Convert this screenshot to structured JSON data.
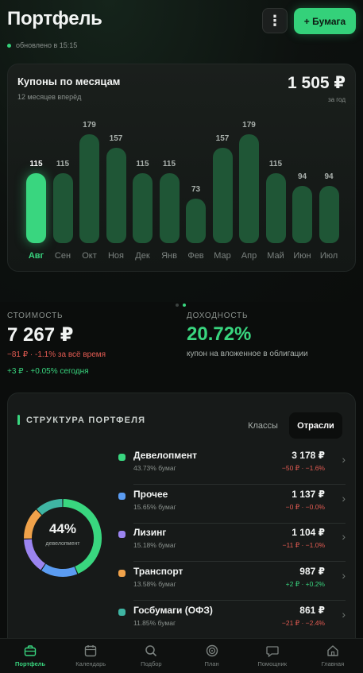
{
  "header": {
    "title": "Портфель",
    "menu_label": "⋮",
    "add_label": "+ Бумага",
    "updated": "обновлено в 15:15"
  },
  "coupons": {
    "title": "Купоны по месяцам",
    "subtitle": "12 месяцев вперёд",
    "total": "1 505 ₽",
    "total_label": "за год"
  },
  "chart_data": {
    "type": "bar",
    "title": "Купоны по месяцам",
    "categories": [
      "Авг",
      "Сен",
      "Окт",
      "Ноя",
      "Дек",
      "Янв",
      "Фев",
      "Мар",
      "Апр",
      "Май",
      "Июн",
      "Июл"
    ],
    "values": [
      115,
      115,
      179,
      157,
      115,
      115,
      73,
      157,
      179,
      115,
      94,
      94
    ],
    "active_index": 0,
    "ylim": [
      0,
      179
    ],
    "grid": false,
    "colors": {
      "bar": "#1f5636",
      "active": "#39d67f"
    }
  },
  "stats": {
    "value_label": "СТОИМОСТЬ",
    "value": "7 267 ₽",
    "change_total": "−81 ₽ · -1.1% за всё время",
    "change_today": "+3 ₽ · +0.05% сегодня",
    "yield_label": "ДОХОДНОСТЬ",
    "yield": "20.72%",
    "yield_note": "купон на вложенное в облигации"
  },
  "structure": {
    "title": "СТРУКТУРА ПОРТФЕЛЯ",
    "tab_classes": "Классы",
    "tab_sectors": "Отрасли",
    "donut_pct": "44%",
    "donut_label": "девелопмент",
    "rows": [
      {
        "name": "Девелопмент",
        "share": "43.73% бумаг",
        "amount": "3 178 ₽",
        "change": "−50 ₽ · −1.6%",
        "color": "#39d67f",
        "trend": "down",
        "fraction": 0.4373
      },
      {
        "name": "Прочее",
        "share": "15.65% бумаг",
        "amount": "1 137 ₽",
        "change": "−0 ₽ · −0.0%",
        "color": "#5b9cf2",
        "trend": "down",
        "fraction": 0.1565
      },
      {
        "name": "Лизинг",
        "share": "15.18% бумаг",
        "amount": "1 104 ₽",
        "change": "−11 ₽ · −1.0%",
        "color": "#9b84f0",
        "trend": "down",
        "fraction": 0.1518
      },
      {
        "name": "Транспорт",
        "share": "13.58% бумаг",
        "amount": "987 ₽",
        "change": "+2 ₽ · +0.2%",
        "color": "#f0a24a",
        "trend": "up",
        "fraction": 0.1358
      },
      {
        "name": "Госбумаги (ОФЗ)",
        "share": "11.85% бумаг",
        "amount": "861 ₽",
        "change": "−21 ₽ · −2.4%",
        "color": "#3fb5a3",
        "trend": "down",
        "fraction": 0.1185
      }
    ]
  },
  "nav": {
    "items": [
      {
        "label": "Портфель",
        "icon": "briefcase-icon",
        "active": true
      },
      {
        "label": "Календарь",
        "icon": "calendar-icon",
        "active": false
      },
      {
        "label": "Подбор",
        "icon": "search-icon",
        "active": false
      },
      {
        "label": "План",
        "icon": "target-icon",
        "active": false
      },
      {
        "label": "Помощник",
        "icon": "chat-icon",
        "active": false
      },
      {
        "label": "Главная",
        "icon": "home-icon",
        "active": false
      }
    ]
  }
}
